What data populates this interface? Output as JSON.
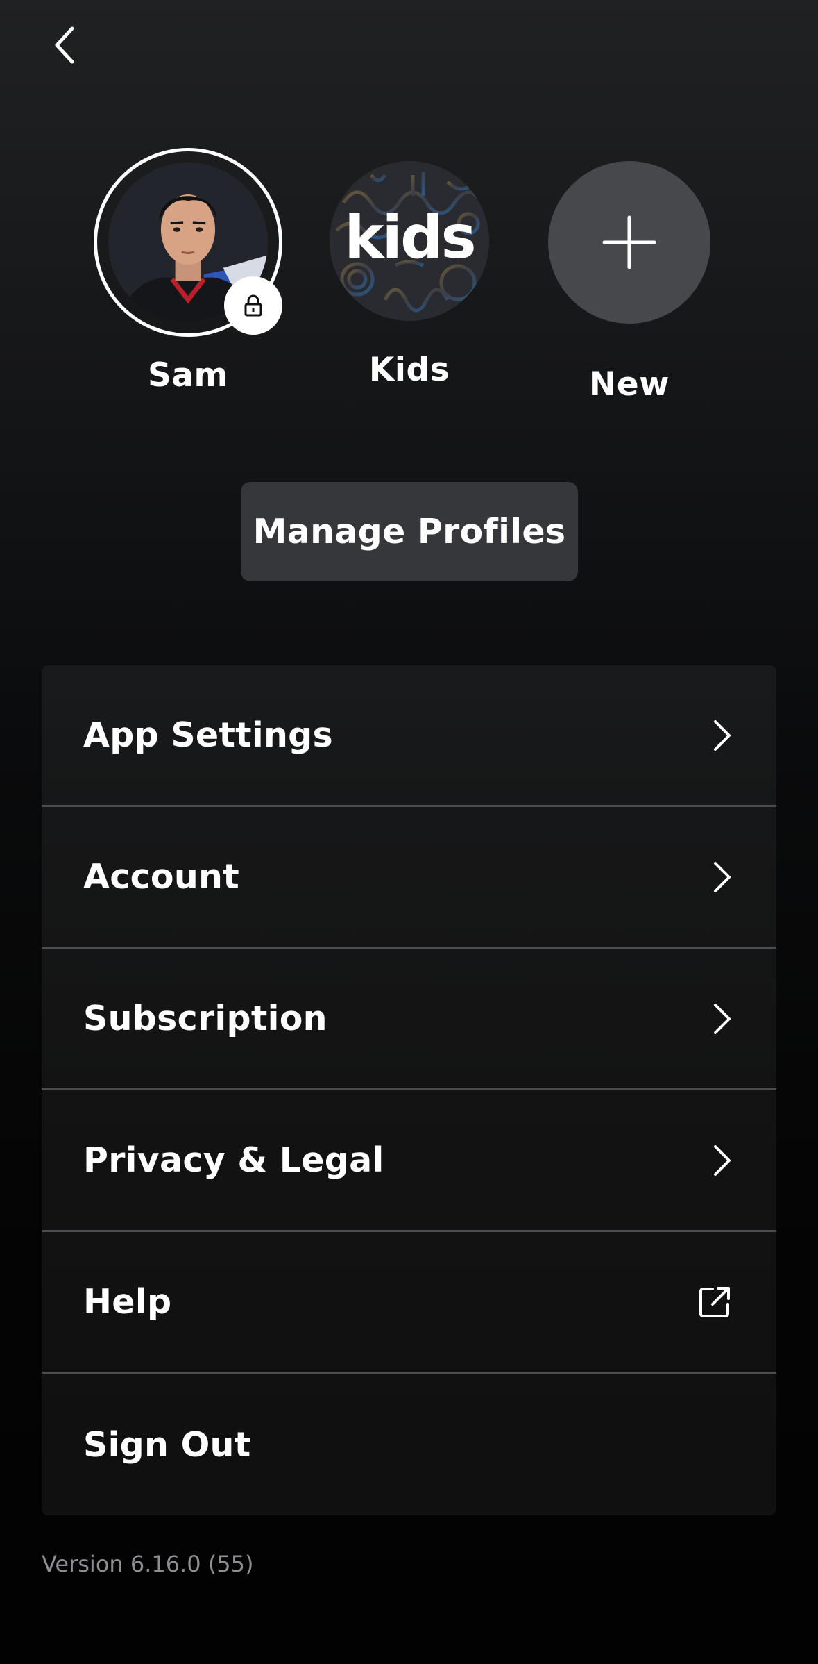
{
  "header": {
    "back_icon": "chevron-left-icon"
  },
  "profiles": [
    {
      "name": "Sam",
      "locked": true,
      "lock_icon": "lock-icon"
    },
    {
      "name": "Kids",
      "logo_text": "kids"
    },
    {
      "name": "New",
      "icon": "plus-icon"
    }
  ],
  "manage_profiles_label": "Manage Profiles",
  "menu": {
    "items": [
      {
        "label": "App Settings",
        "icon": "chevron-right-icon"
      },
      {
        "label": "Account",
        "icon": "chevron-right-icon"
      },
      {
        "label": "Subscription",
        "icon": "chevron-right-icon"
      },
      {
        "label": "Privacy & Legal",
        "icon": "chevron-right-icon"
      },
      {
        "label": "Help",
        "icon": "external-link-icon"
      },
      {
        "label": "Sign Out"
      }
    ]
  },
  "version": "Version 6.16.0 (55)"
}
